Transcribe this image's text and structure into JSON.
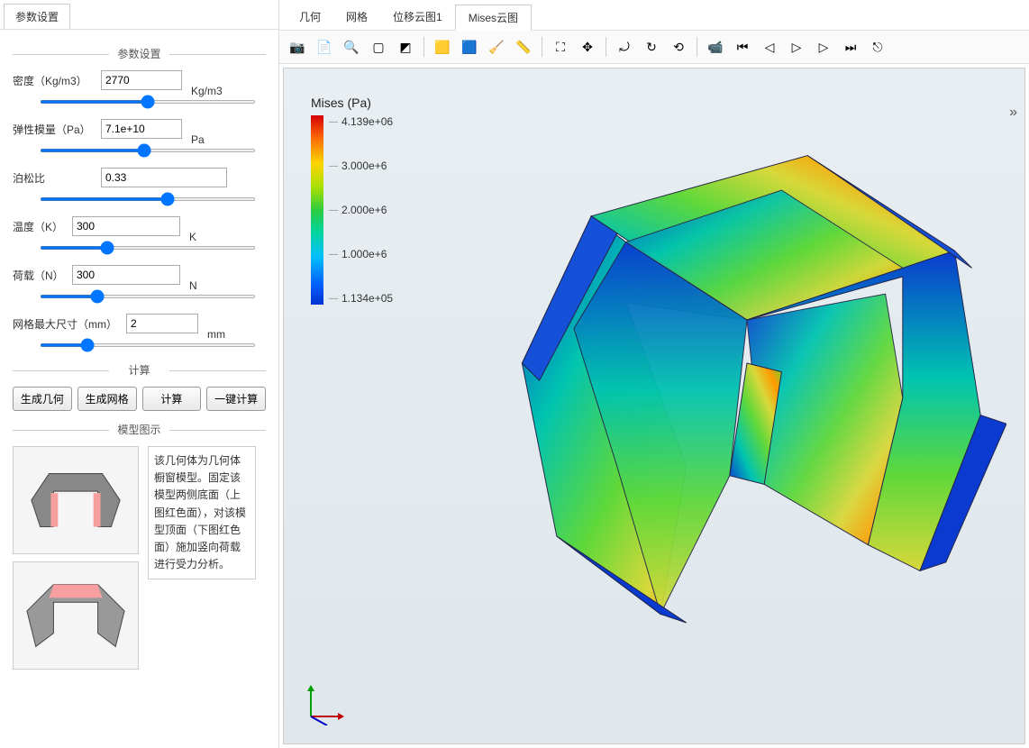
{
  "left_tab": "参数设置",
  "sections": {
    "params_title": "参数设置",
    "calc_title": "计算",
    "model_title": "模型图示"
  },
  "params": {
    "density": {
      "label": "密度（Kg/m3）",
      "value": "2770",
      "unit": "Kg/m3"
    },
    "elastic": {
      "label": "弹性模量（Pa）",
      "value": "7.1e+10",
      "unit": "Pa"
    },
    "poisson": {
      "label": "泊松比",
      "value": "0.33",
      "unit": ""
    },
    "temp": {
      "label": "温度（K）",
      "value": "300",
      "unit": "K"
    },
    "load": {
      "label": "荷载（N）",
      "value": "300",
      "unit": "N"
    },
    "mesh": {
      "label": "网格最大尺寸（mm）",
      "value": "2",
      "unit": "mm"
    }
  },
  "buttons": {
    "gen_geom": "生成几何",
    "gen_mesh": "生成网格",
    "calc": "计算",
    "onekey": "一键计算"
  },
  "model_desc": "该几何体为几何体橱窗模型。固定该模型两侧底面（上图红色面），对该模型顶面（下图红色面）施加竖向荷载进行受力分析。",
  "view_tabs": [
    "几何",
    "网格",
    "位移云图1",
    "Mises云图"
  ],
  "active_view_tab": 3,
  "legend": {
    "title": "Mises (Pa)",
    "ticks": [
      "4.139e+06",
      "3.000e+6",
      "2.000e+6",
      "1.000e+6",
      "1.134e+05"
    ]
  },
  "toolbar_icons": [
    "camera",
    "export",
    "zoom-fit",
    "select-box",
    "select-poly",
    "",
    "box-visible",
    "box-wire",
    "brush",
    "measure",
    "",
    "zoom-area",
    "pan-center",
    "",
    "rotate-xy",
    "rotate-loop",
    "rotate-wire",
    "",
    "cam-record",
    "skip-first",
    "step-back",
    "play",
    "step-fwd",
    "skip-last",
    "export-anim"
  ],
  "toolbar_glyphs": {
    "camera": "📷",
    "export": "📄",
    "zoom-fit": "🔍",
    "select-box": "▢",
    "select-poly": "◩",
    "box-visible": "🟨",
    "box-wire": "🟦",
    "brush": "🧹",
    "measure": "📏",
    "zoom-area": "⛶",
    "pan-center": "✥",
    "rotate-xy": "⤾",
    "rotate-loop": "↻",
    "rotate-wire": "⟲",
    "cam-record": "📹",
    "skip-first": "⏮",
    "step-back": "◁",
    "play": "▷",
    "step-fwd": "▷",
    "skip-last": "⏭",
    "export-anim": "⎋"
  },
  "overflow_glyph": "»"
}
